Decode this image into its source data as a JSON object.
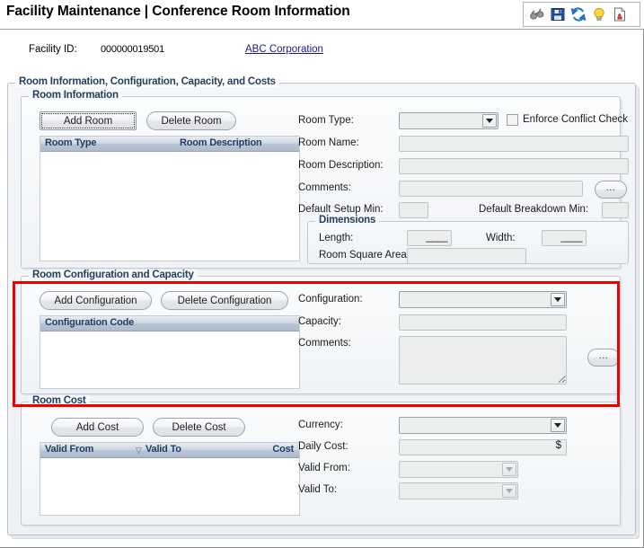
{
  "window": {
    "title": "Facility Maintenance | Conference Room Information"
  },
  "toolbar": {
    "icons": [
      {
        "name": "binoculars-search-icon",
        "label": "Search"
      },
      {
        "name": "save-floppy-icon",
        "label": "Save"
      },
      {
        "name": "refresh-icon",
        "label": "Refresh"
      },
      {
        "name": "lightbulb-hint-icon",
        "label": "Hints"
      },
      {
        "name": "report-document-icon",
        "label": "Report"
      }
    ]
  },
  "facility": {
    "id_label": "Facility ID:",
    "id_value": "000000019501",
    "corporation_link": "ABC Corporation"
  },
  "outer_panel": {
    "title": "Room Information, Configuration, Capacity,  and Costs"
  },
  "room_information": {
    "title": "Room Information",
    "add_button": "Add Room",
    "delete_button": "Delete Room",
    "grid": {
      "columns": [
        "Room Type",
        "Room Description"
      ],
      "rows": []
    },
    "fields": {
      "room_type_label": "Room Type:",
      "room_type_value": "",
      "enforce_conflict_label": "Enforce Conflict Check",
      "enforce_conflict_checked": false,
      "room_name_label": "Room Name:",
      "room_name_value": "",
      "room_description_label": "Room Description:",
      "room_description_value": "",
      "comments_label": "Comments:",
      "comments_value": "",
      "comments_ellipsis": "...",
      "default_setup_label": "Default Setup Min:",
      "default_setup_value": "",
      "default_breakdown_label": "Default Breakdown Min:",
      "default_breakdown_value": ""
    },
    "dimensions": {
      "title": "Dimensions",
      "length_label": "Length:",
      "length_value": "____",
      "width_label": "Width:",
      "width_value": "____",
      "room_square_area_label": "Room Square Area:",
      "room_square_area_value": ""
    }
  },
  "room_configuration": {
    "title": "Room Configuration and Capacity",
    "highlighted": true,
    "highlight_color": "#ee0000",
    "add_button": "Add Configuration",
    "delete_button": "Delete Configuration",
    "grid": {
      "columns": [
        "Configuration Code"
      ],
      "rows": []
    },
    "fields": {
      "configuration_label": "Configuration:",
      "configuration_value": "",
      "capacity_label": "Capacity:",
      "capacity_value": "",
      "comments_label": "Comments:",
      "comments_value": "",
      "comments_ellipsis": "..."
    }
  },
  "room_cost": {
    "title": "Room Cost",
    "add_button": "Add Cost",
    "delete_button": "Delete Cost",
    "grid": {
      "columns": [
        "Valid From",
        "Valid To",
        "Cost"
      ],
      "sort_column": "Valid To",
      "sort_indicator": "▽",
      "rows": []
    },
    "fields": {
      "currency_label": "Currency:",
      "currency_value": "",
      "daily_cost_label": "Daily Cost:",
      "daily_cost_value": "",
      "daily_cost_suffix": "$",
      "valid_from_label": "Valid From:",
      "valid_from_value": "",
      "valid_to_label": "Valid To:",
      "valid_to_value": ""
    }
  },
  "colors": {
    "group_title": "#23405e",
    "link": "#1a1a8c",
    "highlight": "#ee0000",
    "grid_header_text": "#1f3c5f"
  }
}
